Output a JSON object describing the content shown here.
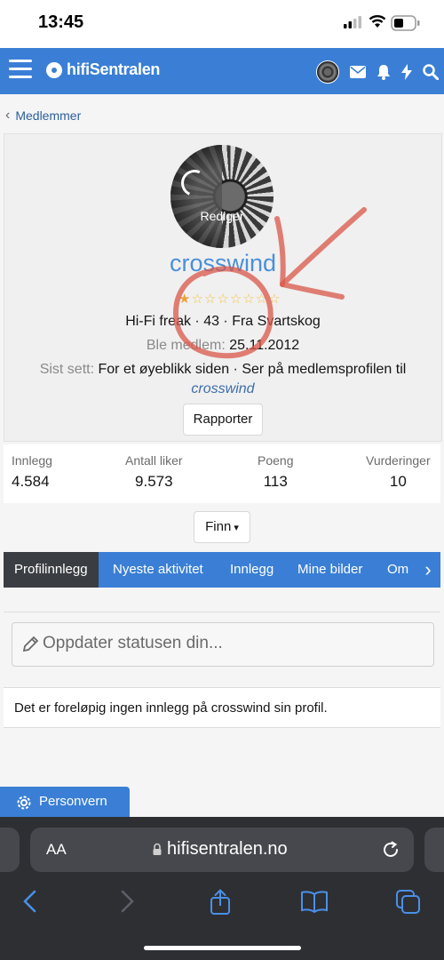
{
  "status_bar": {
    "time": "13:45"
  },
  "header": {
    "logo_prefix": "hifi",
    "logo_main": "Sentralen",
    "icons": [
      "menu-icon",
      "avatar",
      "mail-icon",
      "bell-icon",
      "bolt-icon",
      "search-icon"
    ]
  },
  "breadcrumb": {
    "label": "Medlemmer"
  },
  "profile": {
    "edit_label": "Rediger",
    "username": "crosswind",
    "stars": [
      "★",
      "☆",
      "☆",
      "☆",
      "☆",
      "☆",
      "☆",
      "☆"
    ],
    "summary": "Hi-Fi freak · 43 · Fra Svartskog",
    "joined_label": "Ble medlem:",
    "joined_value": "25.11.2012",
    "seen_label": "Sist sett:",
    "seen_value": "For et øyeblikk siden · Ser på medlemsprofilen til",
    "seen_target": "crosswind",
    "report_button": "Rapporter"
  },
  "stats": [
    {
      "label": "Innlegg",
      "value": "4.584"
    },
    {
      "label": "Antall liker",
      "value": "9.573"
    },
    {
      "label": "Poeng",
      "value": "113"
    },
    {
      "label": "Vurderinger",
      "value": "10"
    }
  ],
  "find_button": "Finn",
  "tabs": [
    "Profilinnlegg",
    "Nyeste aktivitet",
    "Innlegg",
    "Mine bilder",
    "Om"
  ],
  "status_update": {
    "placeholder": "Oppdater statusen din..."
  },
  "empty_message": "Det er foreløpig ingen innlegg på crosswind sin profil.",
  "privacy_button": "Personvern",
  "browser": {
    "aa": "AA",
    "url": "hifisentralen.no"
  },
  "colors": {
    "brand": "#3a7fd5",
    "tab_active": "#3a3d41",
    "username": "#4a8fd8",
    "annotation": "#d9574a"
  }
}
